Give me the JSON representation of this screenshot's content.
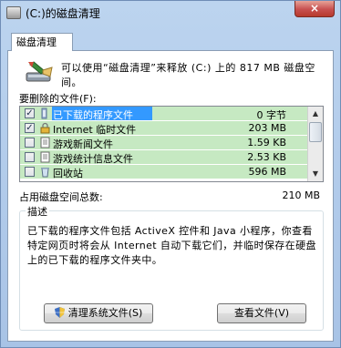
{
  "window": {
    "title": "(C:)的磁盘清理",
    "close_glyph": "×"
  },
  "tab": {
    "label": "磁盘清理"
  },
  "intro": "可以使用“磁盘清理”来释放 (C:) 上的 817 MB 磁盘空间。",
  "list_label": "要删除的文件(F):",
  "files": [
    {
      "name": "已下载的程序文件",
      "size": "0 字节",
      "checked": true,
      "selected": true,
      "icon": "folder-icon"
    },
    {
      "name": "Internet 临时文件",
      "size": "203 MB",
      "checked": true,
      "selected": false,
      "icon": "lock-icon"
    },
    {
      "name": "游戏新闻文件",
      "size": "1.59 KB",
      "checked": false,
      "selected": false,
      "icon": "document-icon"
    },
    {
      "name": "游戏统计信息文件",
      "size": "2.53 KB",
      "checked": false,
      "selected": false,
      "icon": "document-icon"
    },
    {
      "name": "回收站",
      "size": "596 MB",
      "checked": false,
      "selected": false,
      "icon": "recycle-bin-icon"
    }
  ],
  "total": {
    "label": "占用磁盘空间总数:",
    "value": "210 MB"
  },
  "description": {
    "title": "描述",
    "text": "已下载的程序文件包括 ActiveX 控件和 Java 小程序，你查看特定网页时将会从 Internet 自动下载它们，并临时保存在硬盘上的已下载的程序文件夹中。"
  },
  "buttons": {
    "clean_system": "清理系统文件(S)",
    "view_files": "查看文件(V)"
  },
  "colors": {
    "row_bg": "#c6e9c2",
    "selection": "#3399ff",
    "frame": "#a8c3e6"
  }
}
